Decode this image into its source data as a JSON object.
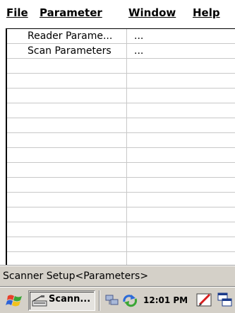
{
  "menu": {
    "file": "File",
    "parameter": "Parameter",
    "window": "Window",
    "help": "Help"
  },
  "grid": {
    "rows": [
      {
        "name": "Reader Parame...",
        "value": "..."
      },
      {
        "name": "Scan Parameters",
        "value": "..."
      }
    ],
    "empty_row_count": 14
  },
  "status": {
    "text": "Scanner Setup<Parameters>"
  },
  "taskbar": {
    "task_label": "Scann...",
    "clock": "12:01 PM",
    "start_icon": "windows-flag-icon",
    "task_icon": "scanner-app-icon",
    "tray_icons": [
      "network-icon",
      "sync-icon",
      "pen-input-icon",
      "switch-windows-icon"
    ]
  }
}
